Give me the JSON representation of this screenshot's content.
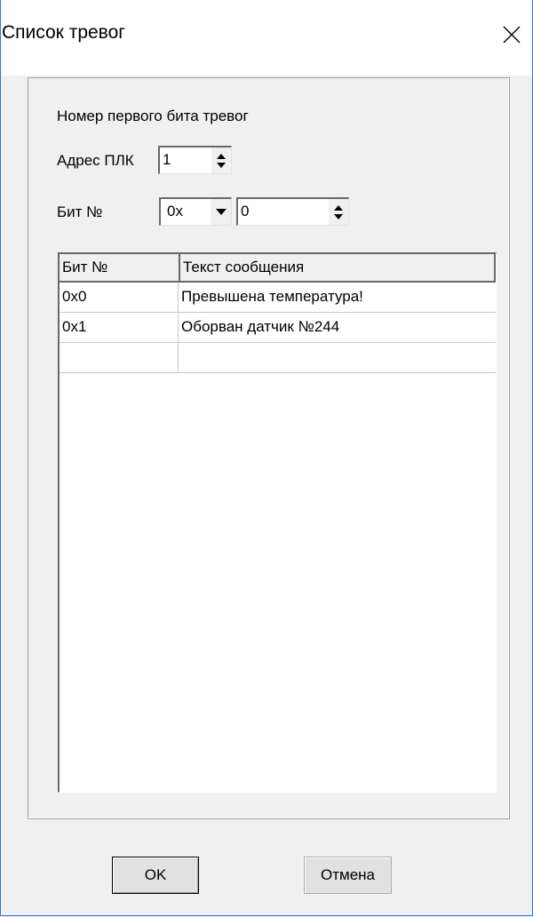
{
  "window": {
    "title": "Список тревог"
  },
  "first_bit": {
    "heading": "Номер первого бита тревог",
    "plc_address_label": "Адрес ПЛК",
    "plc_address_value": "1",
    "bit_label": "Бит №",
    "bit_base_value": "0x",
    "bit_number_value": "0"
  },
  "table": {
    "columns": [
      "Бит №",
      "Текст сообщения"
    ],
    "rows": [
      {
        "bit": "0x0",
        "text": "Превышена температура!"
      },
      {
        "bit": "0x1",
        "text": "Оборван датчик №244"
      },
      {
        "bit": "",
        "text": ""
      }
    ]
  },
  "buttons": {
    "ok": "OK",
    "cancel": "Отмена"
  },
  "icons": [
    "close-icon",
    "spin-up-icon",
    "spin-down-icon",
    "dropdown-arrow-icon"
  ]
}
